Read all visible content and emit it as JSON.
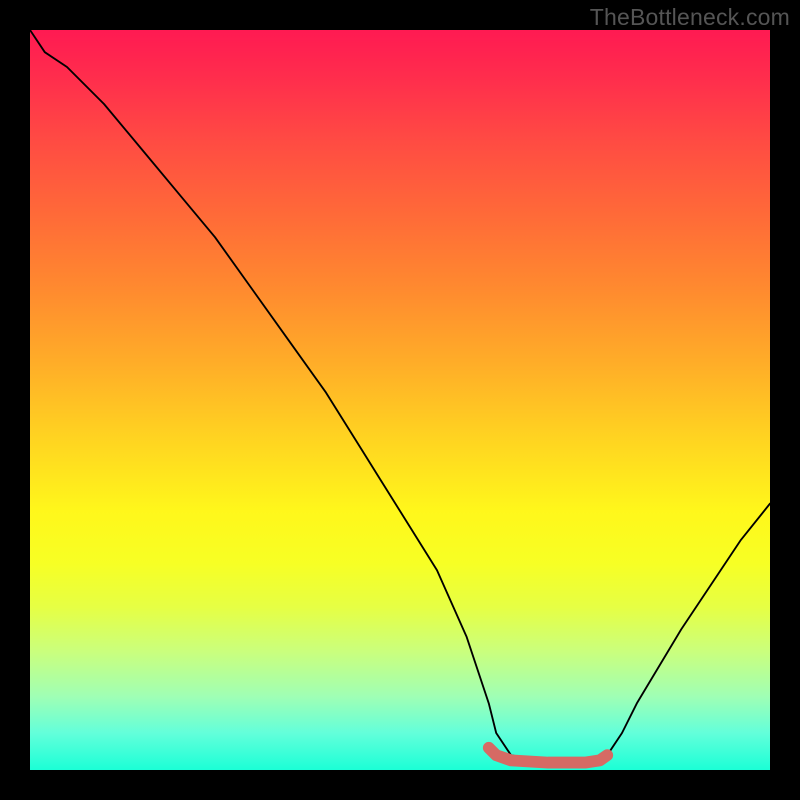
{
  "watermark": {
    "text": "TheBottleneck.com"
  },
  "chart_data": {
    "type": "line",
    "title": "",
    "xlabel": "",
    "ylabel": "",
    "xlim": [
      0,
      100
    ],
    "ylim": [
      0,
      100
    ],
    "series": [
      {
        "name": "bottleneck-curve",
        "x": [
          0,
          2,
          5,
          10,
          15,
          20,
          25,
          30,
          35,
          40,
          45,
          50,
          55,
          59,
          62,
          63,
          65,
          70,
          75,
          77,
          78,
          80,
          82,
          85,
          88,
          92,
          96,
          100
        ],
        "values": [
          100,
          97,
          95,
          90,
          84,
          78,
          72,
          65,
          58,
          51,
          43,
          35,
          27,
          18,
          9,
          5,
          2,
          1,
          1,
          1,
          2,
          5,
          9,
          14,
          19,
          25,
          31,
          36
        ]
      },
      {
        "name": "optimal-zone-highlight",
        "x": [
          62,
          63,
          65,
          70,
          75,
          77,
          78
        ],
        "values": [
          3,
          2,
          1.3,
          1,
          1,
          1.3,
          2
        ]
      }
    ],
    "colors": {
      "curve": "#000000",
      "highlight": "#d66a64"
    }
  }
}
